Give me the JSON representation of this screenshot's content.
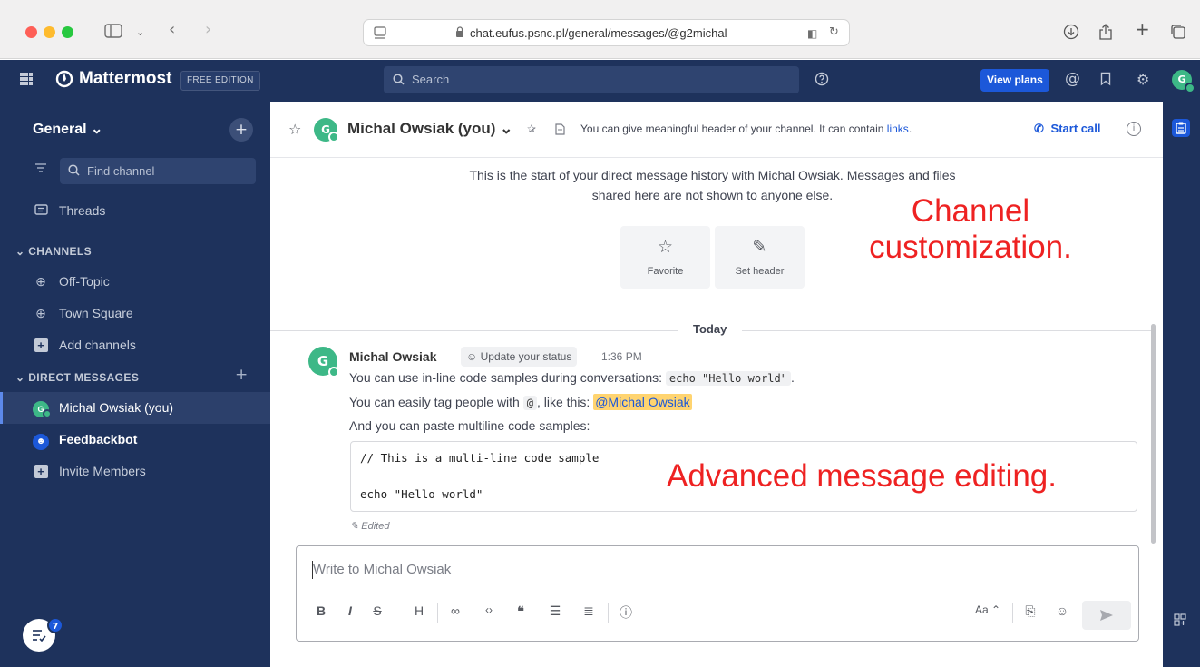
{
  "browser": {
    "url": "chat.eufus.psnc.pl/general/messages/@g2michal"
  },
  "header": {
    "brand": "Mattermost",
    "edition": "FREE EDITION",
    "search_placeholder": "Search",
    "view_plans": "View plans",
    "avatar_initial": "G"
  },
  "sidebar": {
    "team": "General ⌄",
    "find_channel": "Find channel",
    "threads": "Threads",
    "channels_heading": "CHANNELS",
    "channels": [
      {
        "label": "Off-Topic"
      },
      {
        "label": "Town Square"
      },
      {
        "label": "Add channels"
      }
    ],
    "dm_heading": "DIRECT MESSAGES",
    "dms": [
      {
        "label": "Michal Owsiak (you)",
        "initial": "G"
      },
      {
        "label": "Feedbackbot"
      },
      {
        "label": "Invite Members"
      }
    ],
    "badge_count": "7"
  },
  "channel": {
    "name": "Michal Owsiak (you) ⌄",
    "avatar_initial": "G",
    "purpose_text": "You can give meaningful header of your channel. It can contain ",
    "purpose_link": "links",
    "purpose_end": ".",
    "start_call": "Start call",
    "intro_line1": "This is the start of your direct message history with Michal Owsiak. Messages and files",
    "intro_line2": "shared here are not shown to anyone else.",
    "favorite": "Favorite",
    "set_header": "Set header",
    "date_separator": "Today"
  },
  "post": {
    "author": "Michal Owsiak",
    "avatar_initial": "G",
    "status": "Update your status",
    "time": "1:36 PM",
    "line1_text": "You can use in-line code samples during conversations: ",
    "line1_code": "echo \"Hello world\"",
    "line1_end": ".",
    "line2_text": "You can easily tag people with ",
    "line2_code": "@",
    "line2_mid": ", like this: ",
    "line2_mention": "@Michal Owsiak",
    "line3_text": "And you can paste multiline code samples:",
    "code_line1": "// This is a multi-line code sample",
    "code_line2": "echo \"Hello world\"",
    "edited": "Edited"
  },
  "annotations": {
    "channel_1": "Channel",
    "channel_2": "customization.",
    "editing": "Advanced message editing."
  },
  "composer": {
    "placeholder": "Write to Michal Owsiak",
    "text_size": "Aa ⌃"
  },
  "colors": {
    "sidebar_bg": "#1e325c",
    "accent": "#1c58d9",
    "online": "#3db887",
    "mention_bg": "#ffd470",
    "annotation": "#ee2222"
  }
}
